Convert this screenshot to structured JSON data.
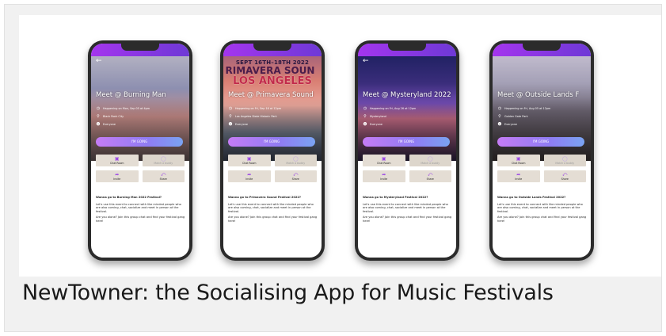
{
  "caption": "NewTowner: the Socialising App  for Music Festivals",
  "colors": {
    "accent": "#a435ee",
    "button_gradient": [
      "#c57cf5",
      "#7aa3f2"
    ],
    "tile_bg": "#e4ddd4"
  },
  "phones": [
    {
      "event_title": "Meet @ Burning Man",
      "info": [
        "Happening on Mon, Sep 05 at 4pm",
        "Black Rock City",
        "Everyone"
      ],
      "going_label": "I'M GOING",
      "tiles": {
        "chat": "Chat Room",
        "match": "Match a buddy",
        "invite": "Invite",
        "share": "Share"
      },
      "question": "Wanna go to Burning Man 2022 Festival?",
      "p1": "Let's use this event to connect with like minded people who are also coming, chat, socialize and meet in person at the festival.",
      "p2": "Are you alone? Join this group chat and find your festival gang here!"
    },
    {
      "poster_date": "SEPT 16TH–18TH 2022",
      "poster_line1": "RIMAVERA SOUN",
      "poster_line2": "LOS ANGELES",
      "event_title": "Meet @ Primavera Sound",
      "info": [
        "Happening on Fri, Sep 16 at 12pm",
        "Los Angeles State Historic Park",
        "Everyone"
      ],
      "going_label": "I'M GOING",
      "tiles": {
        "chat": "Chat Room",
        "match": "Match a buddy",
        "invite": "Invite",
        "share": "Share"
      },
      "question": "Wanna go to Primavera Sound Festival 2022?",
      "p1": "Let's use this event to connect with like minded people who are also coming, chat, socialize and meet in person at the festival.",
      "p2": "Are you alone? Join this group chat and find your festival gang here!"
    },
    {
      "event_title": "Meet @ Mysteryland 2022",
      "info": [
        "Happening on Fri, Aug 26 at 12pm",
        "Mysteryland",
        "Everyone"
      ],
      "going_label": "I'M GOING",
      "tiles": {
        "chat": "Chat Room",
        "match": "Match a buddy",
        "invite": "Invite",
        "share": "Share"
      },
      "question": "Wanna go to Mysteryland Festival 2022?",
      "p1": "Let's use this event to connect with like minded people who are also coming, chat, socialize and meet in person at the festival.",
      "p2": "Are you alone? Join this group chat and find your festival gang here!"
    },
    {
      "event_title": "Meet @ Outside Lands F",
      "info": [
        "Happening on Fri, Aug 05 at 12pm",
        "Golden Gate Park",
        "Everyone"
      ],
      "going_label": "I'M GOING",
      "tiles": {
        "chat": "Chat Room",
        "match": "Match a buddy",
        "invite": "Invite",
        "share": "Share"
      },
      "question": "Wanna go to Outside Lands Festival 2022?",
      "p1": "Let's use this event to connect with like minded people who are also coming, chat, socialize and meet in person at the festival.",
      "p2": "Are you alone? Join this group chat and find your festival gang here!"
    }
  ]
}
